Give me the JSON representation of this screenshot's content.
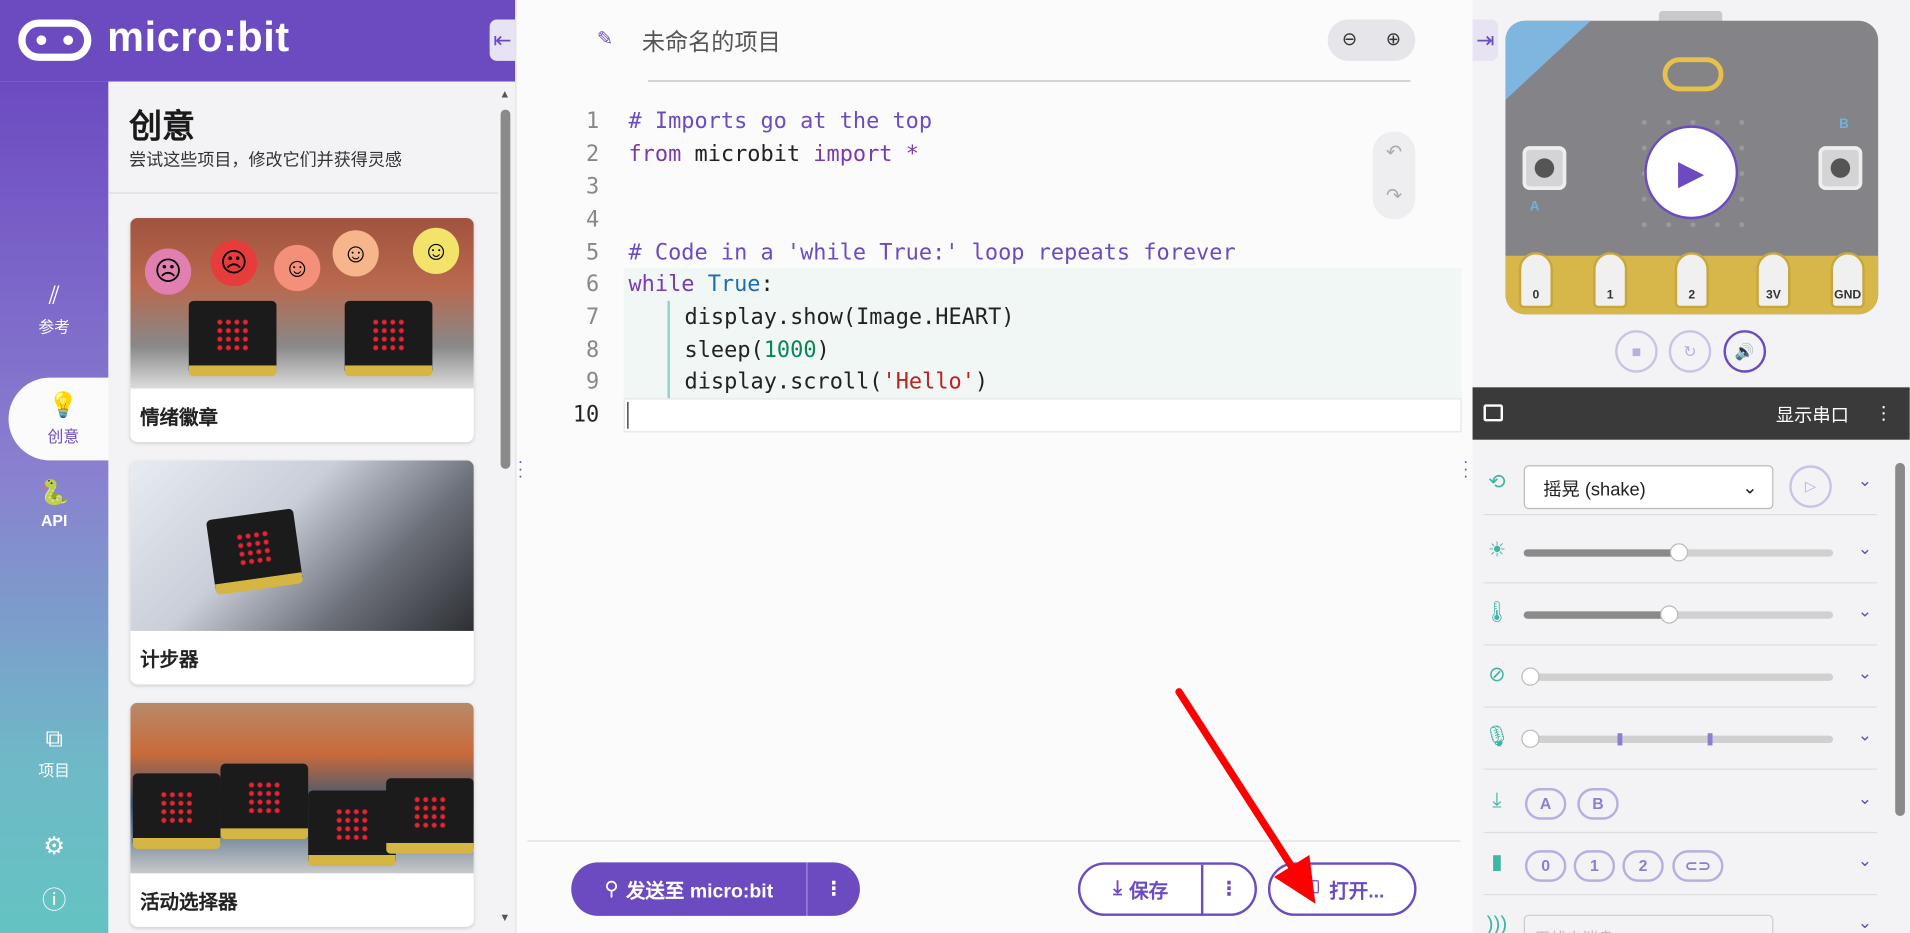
{
  "header": {
    "brand": "micro:bit",
    "collapse_icon": "collapse-left-icon"
  },
  "nav": {
    "items": [
      {
        "label": "参考",
        "icon": "book-icon"
      },
      {
        "label": "创意",
        "icon": "bulb-icon",
        "active": true
      },
      {
        "label": "API",
        "icon": "python-icon"
      },
      {
        "label": "项目",
        "icon": "files-icon"
      }
    ],
    "settings_icon": "gear-icon",
    "help_icon": "help-icon"
  },
  "ideas": {
    "title": "创意",
    "subtitle": "尝试这些项目，修改它们并获得灵感",
    "cards": [
      {
        "label": "情绪徽章"
      },
      {
        "label": "计步器"
      },
      {
        "label": "活动选择器"
      }
    ]
  },
  "editor": {
    "project_name": "未命名的项目",
    "line_numbers": [
      "1",
      "2",
      "3",
      "4",
      "5",
      "6",
      "7",
      "8",
      "9",
      "10"
    ],
    "code": {
      "l1": "# Imports go at the top",
      "l2_kw1": "from",
      "l2_mod": " microbit ",
      "l2_kw2": "import",
      "l2_star": " *",
      "l5": "# Code in a 'while True:' loop repeats forever",
      "l6_kw": "while",
      "l6_true": " True",
      "l6_colon": ":",
      "l7": "display.show(Image.HEART)",
      "l8_a": "sleep(",
      "l8_num": "1000",
      "l8_b": ")",
      "l9_a": "display.scroll(",
      "l9_str": "'Hello'",
      "l9_b": ")"
    }
  },
  "toolbar": {
    "send_label": "发送至 micro:bit",
    "save_label": "保存",
    "open_label": "打开..."
  },
  "simulator": {
    "pins": [
      "0",
      "1",
      "2",
      "3V",
      "GND"
    ],
    "button_a": "A",
    "button_b": "B",
    "serial_label": "显示串口",
    "gesture_value": "摇晃 (shake)",
    "light_level": 0.5,
    "temperature_level": 0.47,
    "compass_level": 0.0,
    "sound_level": 0.0,
    "press_buttons": [
      "A",
      "B"
    ],
    "touch_pins": [
      "0",
      "1",
      "2"
    ],
    "radio_placeholder": "无线电消息"
  },
  "colors": {
    "accent": "#6c4bc1",
    "teal": "#3fb5a3",
    "annotation_arrow": "#ff0000"
  }
}
